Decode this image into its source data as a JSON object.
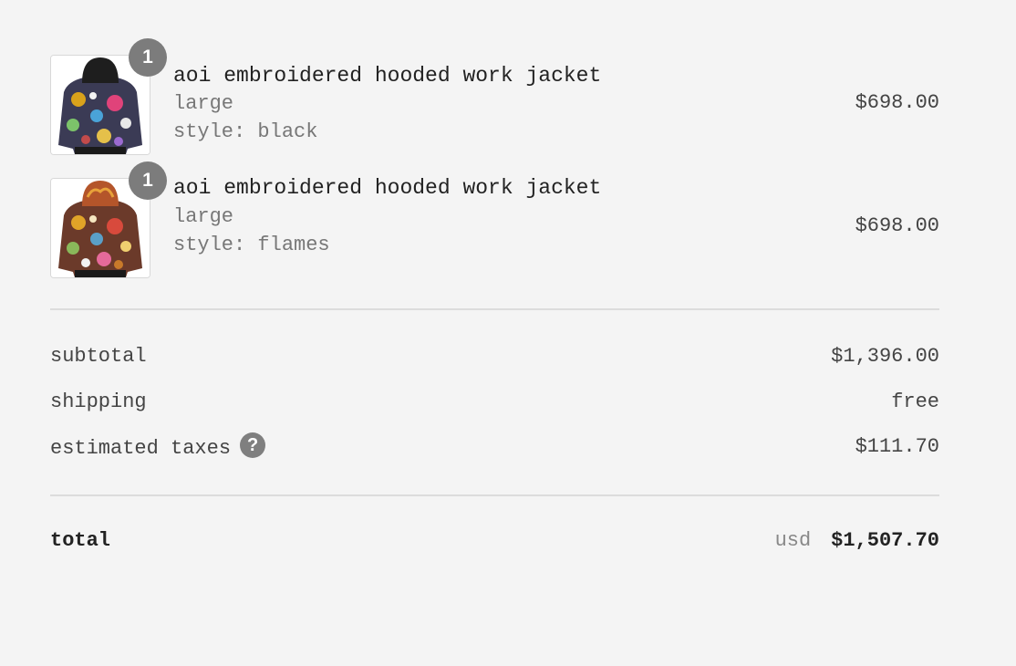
{
  "items": [
    {
      "quantity": "1",
      "name": "aoi embroidered hooded work jacket",
      "size": "large",
      "style": "style: black",
      "price": "$698.00",
      "hood_color": "#1e1e1e"
    },
    {
      "quantity": "1",
      "name": "aoi embroidered hooded work jacket",
      "size": "large",
      "style": "style: flames",
      "price": "$698.00",
      "hood_color": "#b4552a"
    }
  ],
  "summary": {
    "subtotal_label": "subtotal",
    "subtotal_value": "$1,396.00",
    "shipping_label": "shipping",
    "shipping_value": "free",
    "taxes_label": "estimated taxes",
    "taxes_help": "?",
    "taxes_value": "$111.70"
  },
  "total": {
    "label": "total",
    "currency": "usd",
    "amount": "$1,507.70"
  },
  "colors": {
    "background": "#f4f4f4",
    "badge": "#7c7c7c",
    "divider": "#dcdcdc"
  }
}
